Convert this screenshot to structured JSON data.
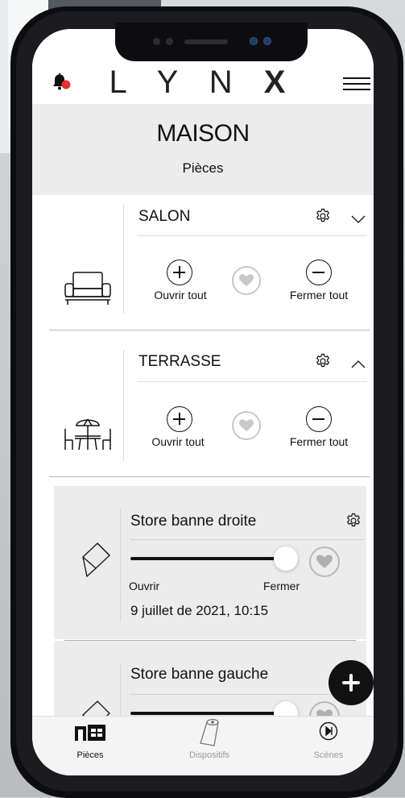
{
  "header": {
    "logo_light": "L Y N",
    "logo_bold": "X"
  },
  "page": {
    "title": "MAISON",
    "subtitle": "Pièces"
  },
  "rooms": [
    {
      "name": "SALON",
      "icon": "armchair-icon",
      "expanded": false,
      "open_label": "Ouvrir tout",
      "close_label": "Fermer tout"
    },
    {
      "name": "TERRASSE",
      "icon": "patio-table-icon",
      "expanded": true,
      "open_label": "Ouvrir tout",
      "close_label": "Fermer tout"
    }
  ],
  "devices": [
    {
      "name": "Store banne droite",
      "icon": "awning-icon",
      "position": 1.0,
      "open_label": "Ouvrir",
      "close_label": "Fermer",
      "last_update": "9 juillet de 2021, 10:15"
    },
    {
      "name": "Store banne gauche",
      "icon": "awning-icon",
      "position": 1.0
    }
  ],
  "tabs": [
    {
      "label": "Pièces",
      "icon": "rooms-icon",
      "active": true
    },
    {
      "label": "Dispositifs",
      "icon": "devices-icon",
      "active": false
    },
    {
      "label": "Scènes",
      "icon": "scenes-icon",
      "active": false
    }
  ],
  "colors": {
    "notification_dot": "#e8302a",
    "accent": "#111111",
    "panel_bg": "#ececec"
  }
}
